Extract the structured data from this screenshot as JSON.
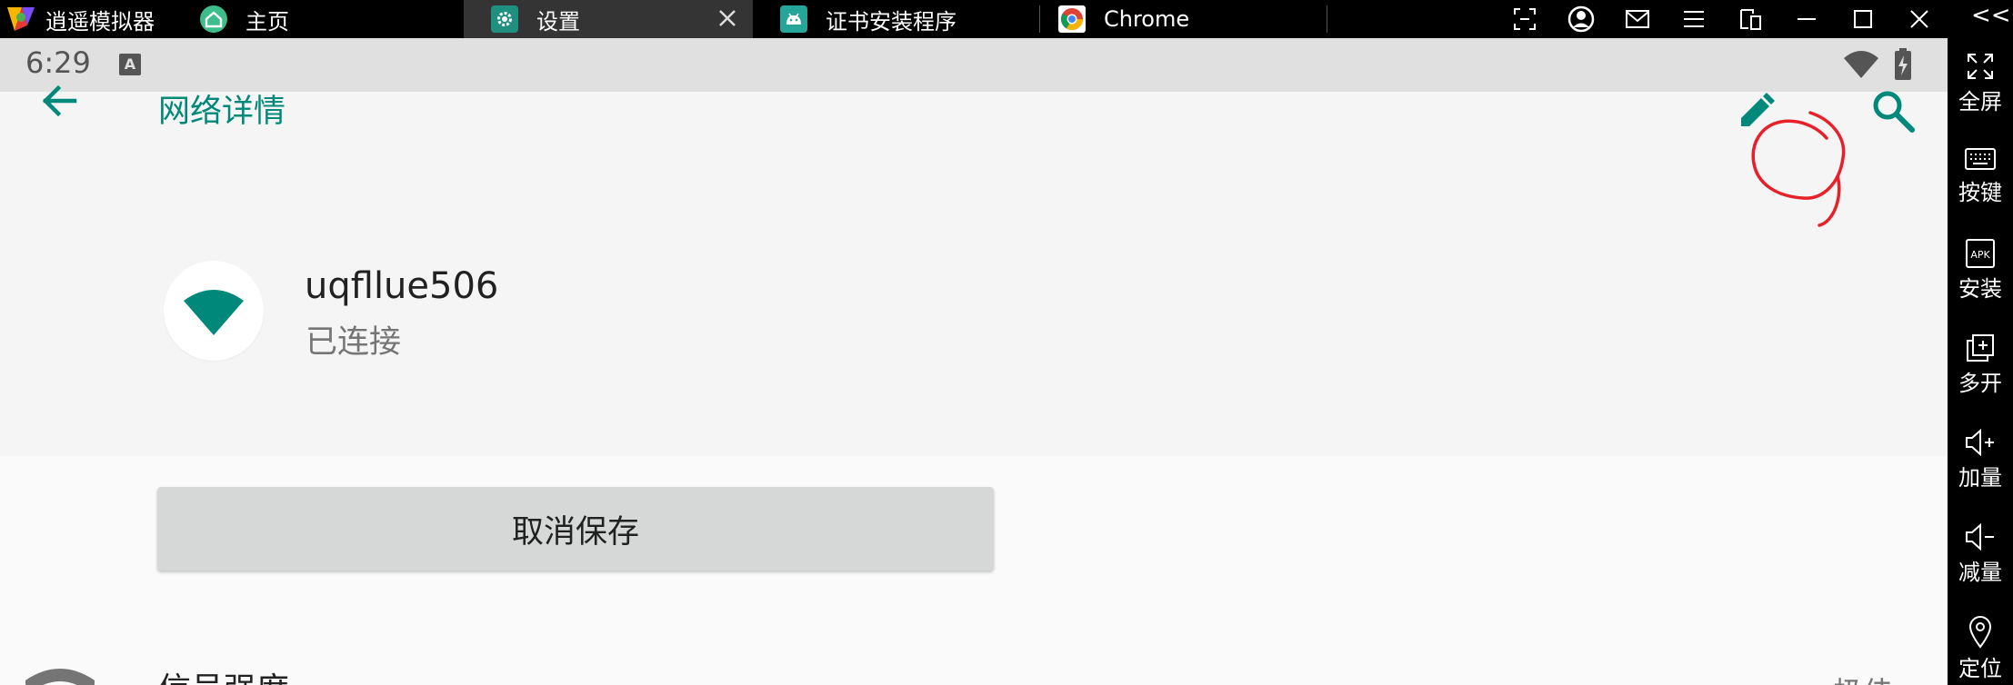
{
  "emulator": {
    "app_title": "逍遥模拟器",
    "tabs": [
      {
        "label": "主页",
        "icon": "home-icon",
        "active": false
      },
      {
        "label": "设置",
        "icon": "settings-gear-icon",
        "active": true
      },
      {
        "label": "证书安装程序",
        "icon": "android-icon",
        "active": false
      },
      {
        "label": "Chrome",
        "icon": "chrome-icon",
        "active": false
      }
    ],
    "window_controls": [
      "screenshot-icon",
      "account-icon",
      "mail-icon",
      "menu-icon",
      "shrink-icon",
      "minimize-icon",
      "maximize-icon",
      "close-icon"
    ],
    "sidebar": {
      "collapse_label": "<<<",
      "items": [
        {
          "label": "全屏",
          "icon": "fullscreen-icon"
        },
        {
          "label": "按键",
          "icon": "keyboard-icon"
        },
        {
          "label": "安装",
          "icon": "apk-install-icon"
        },
        {
          "label": "多开",
          "icon": "multi-instance-icon"
        },
        {
          "label": "加量",
          "icon": "volume-up-icon"
        },
        {
          "label": "减量",
          "icon": "volume-down-icon"
        },
        {
          "label": "定位",
          "icon": "location-icon"
        }
      ]
    }
  },
  "android": {
    "status_bar": {
      "time": "6:29",
      "notification_glyph": "A"
    },
    "app_bar": {
      "title": "网络详情"
    },
    "network": {
      "name": "uqfllue506",
      "status": "已连接"
    },
    "forget_button": "取消保存",
    "signal_row": {
      "label": "信号强度",
      "value": "极佳"
    }
  },
  "colors": {
    "accent": "#00897b",
    "annotation_red": "#e8202a",
    "emulator_chrome": "#000000",
    "active_tab": "#343434"
  }
}
